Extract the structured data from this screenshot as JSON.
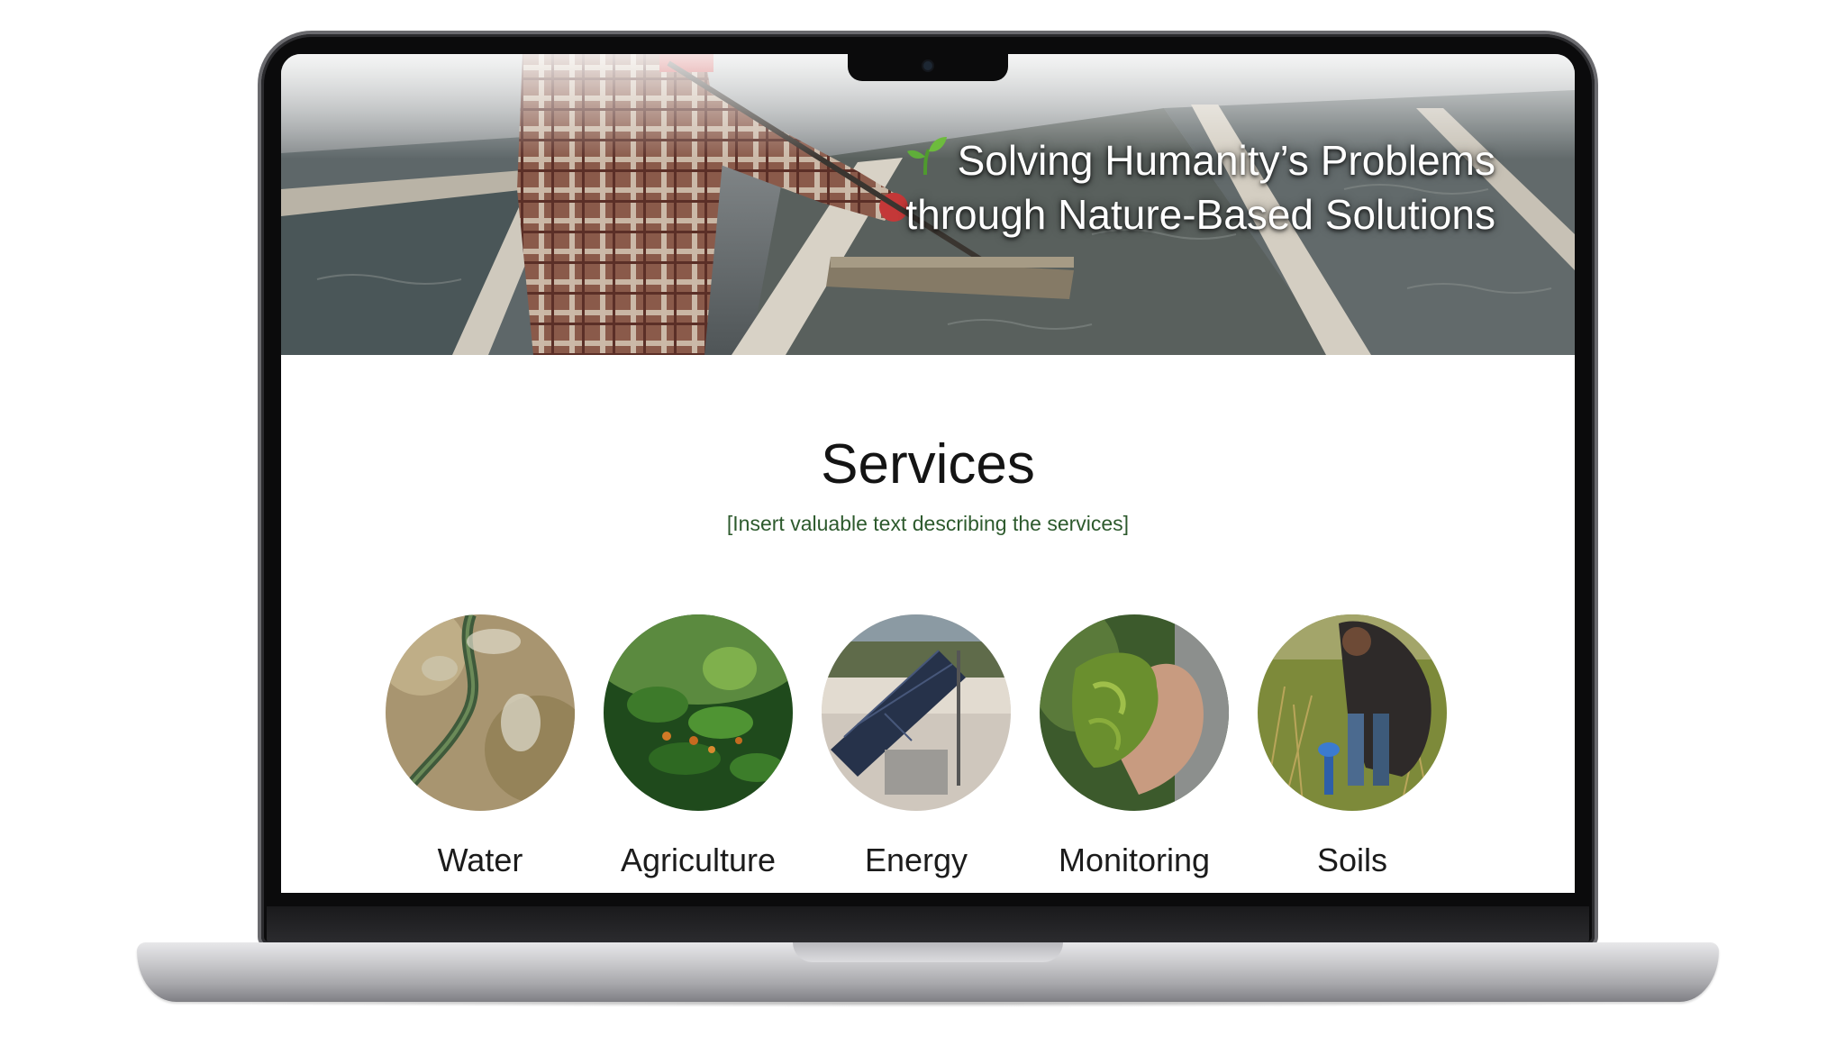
{
  "hero": {
    "title_line1": "Solving Humanity’s Problems",
    "title_line2": "through Nature-Based Solutions"
  },
  "services": {
    "title": "Services",
    "subtitle": "[Insert valuable text describing the services]",
    "items": [
      {
        "label": "Water",
        "image": "water-image"
      },
      {
        "label": "Agriculture",
        "image": "agriculture-image"
      },
      {
        "label": "Energy",
        "image": "energy-image"
      },
      {
        "label": "Monitoring",
        "image": "monitoring-image"
      },
      {
        "label": "Soils",
        "image": "soils-image"
      }
    ]
  },
  "colors": {
    "subtitle": "#2d5a2d",
    "heading": "#141414",
    "sprout": "#5fae3a"
  }
}
